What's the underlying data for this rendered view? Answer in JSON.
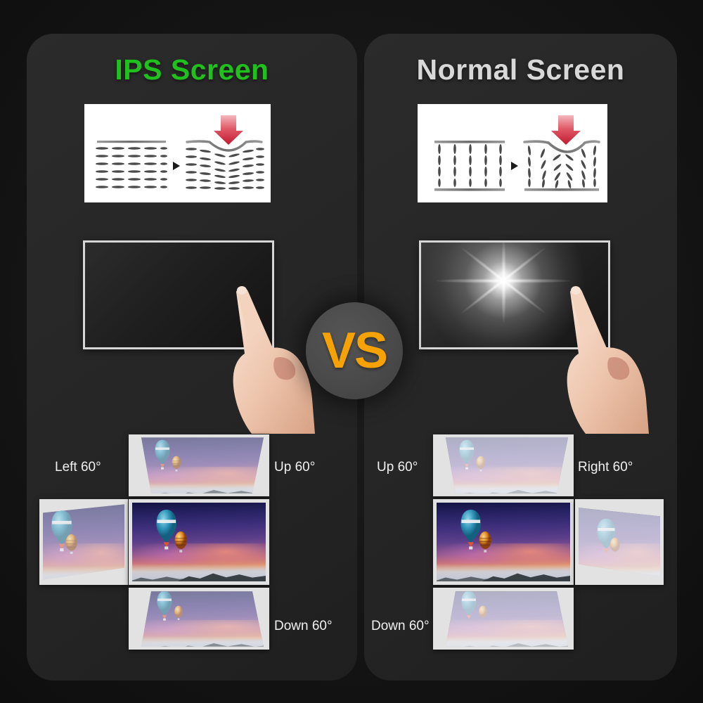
{
  "left_panel": {
    "title": "IPS Screen",
    "title_color": "#22c01e",
    "diagram": {
      "name": "ips-molecule-pressure-diagram",
      "description": "horizontal liquid-crystal rows deform smoothly under downward pressure arrow",
      "arrow": "red-down-arrow",
      "separator": "right-triangle-arrow"
    },
    "screen_demo": {
      "name": "ips-touch-no-ripple",
      "state": "no white glow under finger press"
    },
    "angles": [
      {
        "id": "up",
        "label": "Up 60°",
        "quality": "clear"
      },
      {
        "id": "left",
        "label": "Left 60°",
        "quality": "clear"
      },
      {
        "id": "center",
        "label": "",
        "quality": "reference"
      },
      {
        "id": "down",
        "label": "Down 60°",
        "quality": "clear"
      }
    ]
  },
  "right_panel": {
    "title": "Normal Screen",
    "title_color": "#d8d8d8",
    "diagram": {
      "name": "tn-molecule-pressure-diagram",
      "description": "vertical liquid-crystal columns scatter chaotically under downward pressure arrow",
      "arrow": "red-down-arrow",
      "separator": "right-triangle-arrow"
    },
    "screen_demo": {
      "name": "normal-touch-white-ripple",
      "state": "bright white glow halo under finger press"
    },
    "angles": [
      {
        "id": "up",
        "label": "Up 60°",
        "quality": "washed-out"
      },
      {
        "id": "right",
        "label": "Right 60°",
        "quality": "washed-out"
      },
      {
        "id": "center",
        "label": "",
        "quality": "reference"
      },
      {
        "id": "down",
        "label": "Down 60°",
        "quality": "washed-out"
      }
    ]
  },
  "versus": {
    "label": "VS",
    "text_color": "#f5a202",
    "circle_color": "#4a4a4a"
  },
  "theme": {
    "background": "#121212",
    "panel_background": "#272727",
    "label_color": "#f1f1f1"
  }
}
